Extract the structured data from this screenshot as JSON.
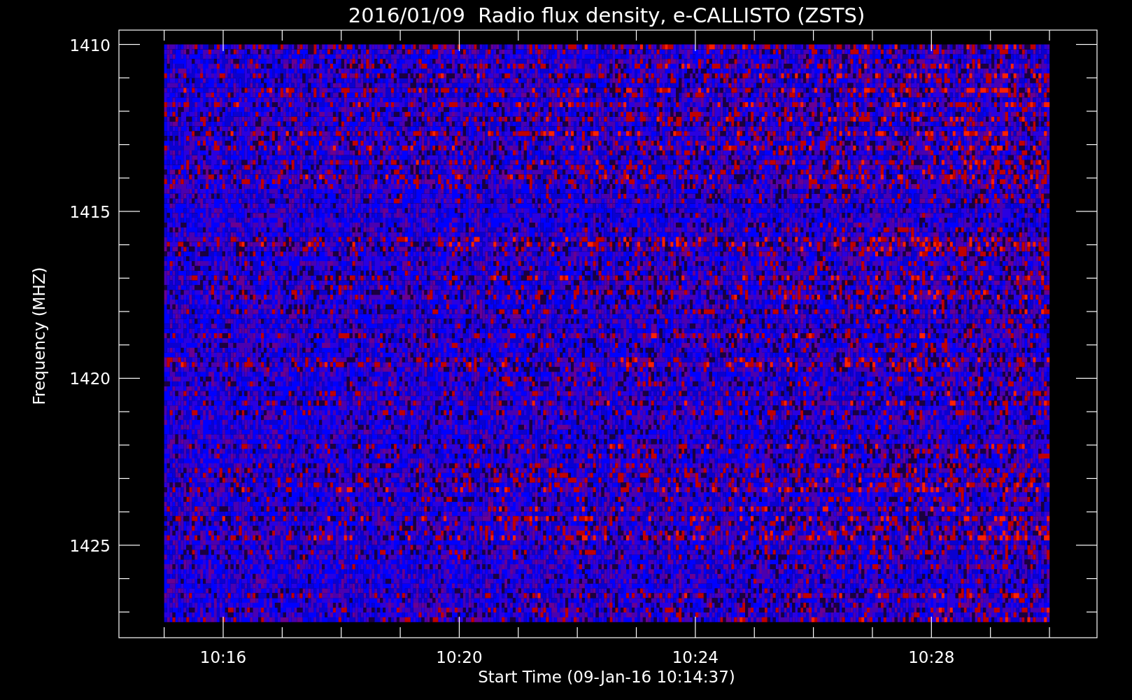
{
  "title": "2016/01/09  Radio flux density, e-CALLISTO (ZSTS)",
  "y_axis": {
    "label": "Frequency (MHZ)",
    "tick_labels": [
      "1410",
      "1415",
      "1420",
      "1425"
    ]
  },
  "x_axis": {
    "label": "Start Time (09-Jan-16 10:14:37)",
    "tick_labels": [
      "10:16",
      "10:20",
      "10:24",
      "10:28"
    ]
  }
}
